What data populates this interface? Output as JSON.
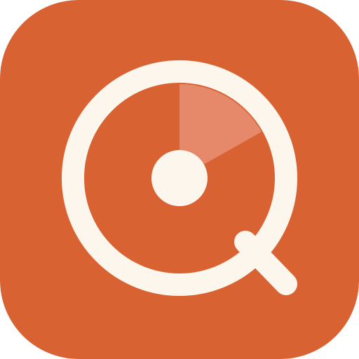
{
  "app_icon": {
    "icon": "radar-search-icon",
    "colors": {
      "background": "#D96233",
      "foreground": "#FDF6EC",
      "sweep": "#E6896A"
    }
  }
}
